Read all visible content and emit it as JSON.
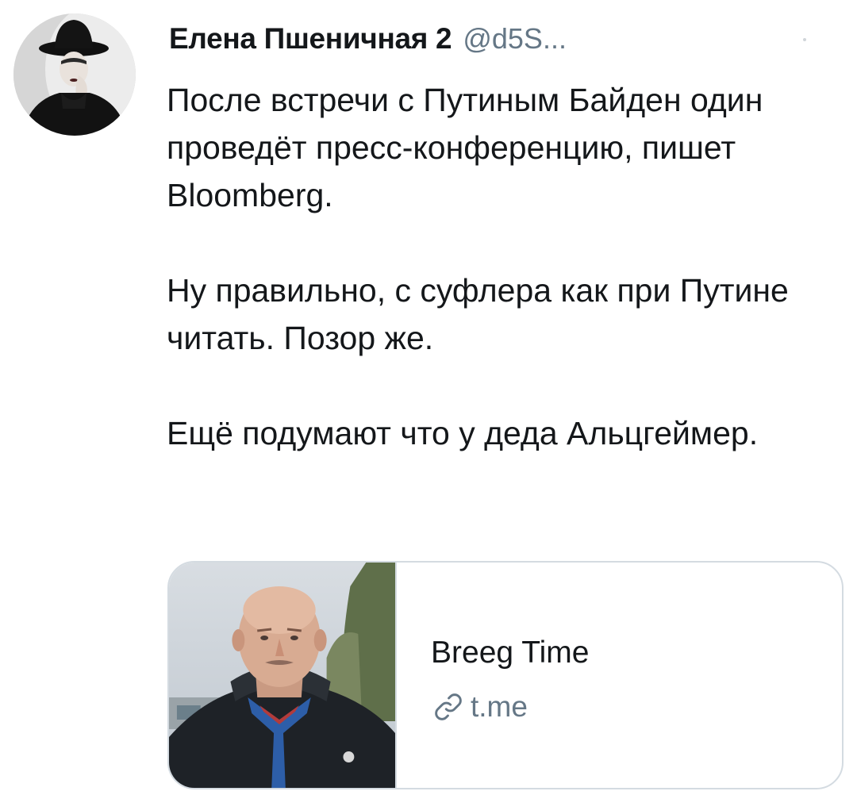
{
  "author": {
    "display_name": "Елена Пшеничная 2",
    "handle": "@d5S...",
    "avatar_icon": "profile-photo-woman-in-hat"
  },
  "tweet": {
    "paragraphs": [
      "После встречи с Путиным Байден один проведёт пресс-конференцию, пишет Bloomberg.",
      "Ну правильно, с суфлера как при Путине читать. Позор же.",
      "Ещё подумают что у деда Альцгеймер."
    ]
  },
  "link_card": {
    "title": "Breeg Time",
    "domain": "t.me",
    "link_icon": "link-icon",
    "thumbnail_icon": "portrait-photo-man"
  },
  "colors": {
    "text": "#14171a",
    "secondary": "#657786",
    "border": "#d4dbe1"
  }
}
